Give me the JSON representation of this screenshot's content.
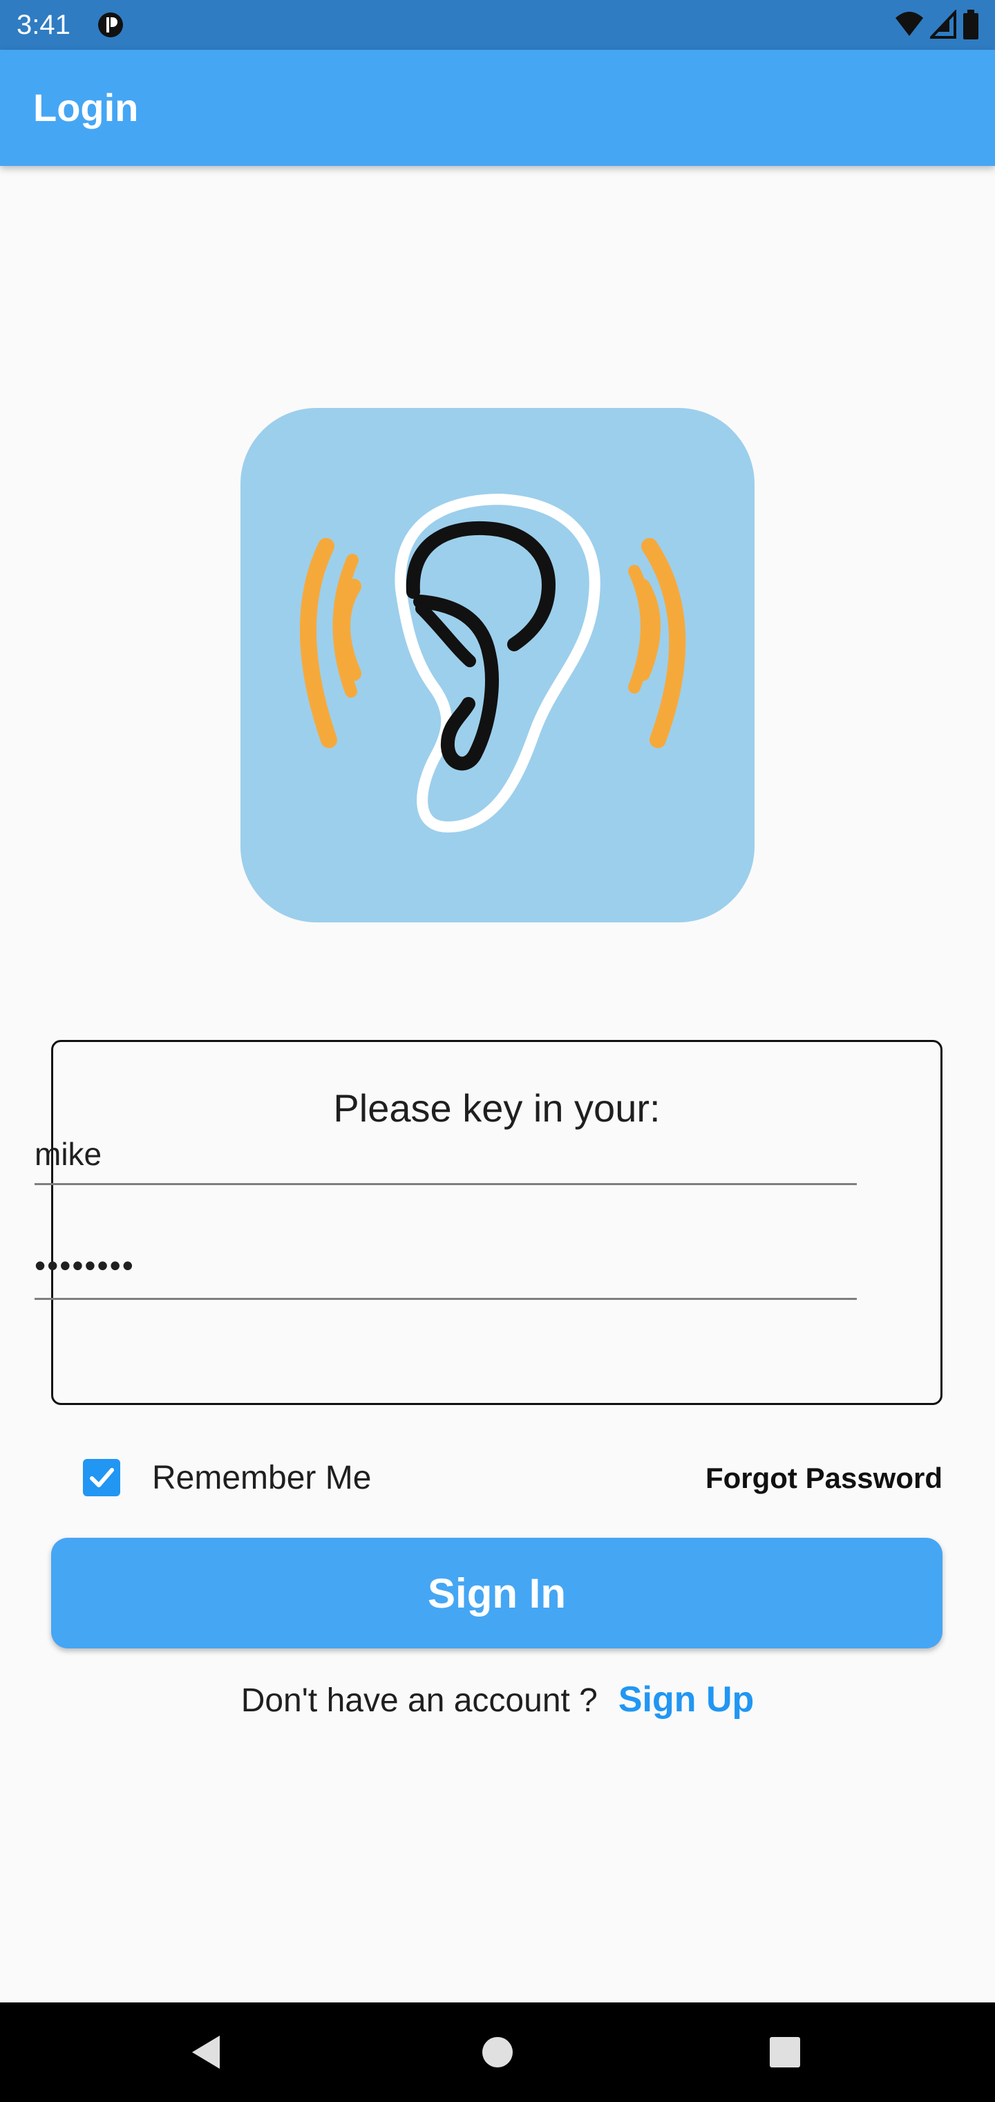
{
  "status_bar": {
    "time": "3:41",
    "app_icon": "circle-p-icon",
    "wifi_icon": "wifi-icon",
    "signal_icon": "signal-icon",
    "battery_icon": "battery-icon"
  },
  "app_bar": {
    "title": "Login"
  },
  "logo": {
    "icon": "ear-sound-icon",
    "colors": {
      "background": "#9CCFEC",
      "waves": "#F6A93B",
      "ear_outline": "#FFFFFF",
      "ear_inner": "#111111"
    }
  },
  "login_form": {
    "title": "Please key in your:",
    "username": {
      "value": "mike"
    },
    "password": {
      "value": "••••••••"
    }
  },
  "options": {
    "remember_me_label": "Remember Me",
    "remember_me_checked": true,
    "forgot_password_label": "Forgot Password"
  },
  "actions": {
    "sign_in_label": "Sign In"
  },
  "signup": {
    "prompt": "Don't have an account ?",
    "link": "Sign Up"
  },
  "colors": {
    "status_bar": "#2F7CC2",
    "app_bar": "#45A6F4",
    "accent": "#2196F3",
    "background": "#FAFAFA",
    "nav_bar": "#000000"
  },
  "navigation": {
    "back_icon": "back-triangle-icon",
    "home_icon": "home-circle-icon",
    "recent_icon": "recent-square-icon"
  }
}
